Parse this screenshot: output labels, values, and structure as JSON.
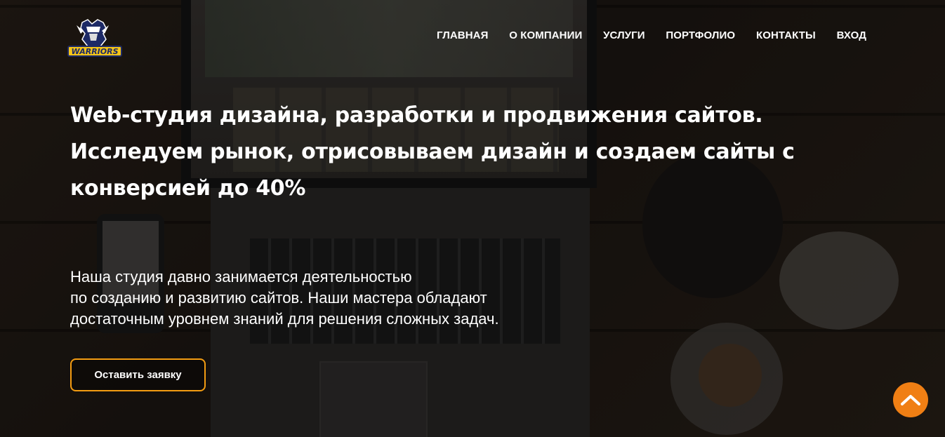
{
  "logo": {
    "text": "WARRIORS",
    "icon": "warriors-logo-icon"
  },
  "nav": {
    "items": [
      {
        "label": "ГЛАВНАЯ"
      },
      {
        "label": "О КОМПАНИИ"
      },
      {
        "label": "УСЛУГИ"
      },
      {
        "label": "ПОРТФОЛИО"
      },
      {
        "label": "КОНТАКТЫ"
      },
      {
        "label": "ВХОД"
      }
    ]
  },
  "hero": {
    "headline": "Web-студия дизайна, разработки и продвижения сайтов. Исследуем рынок, отрисовываем дизайн и создаем сайты с конверсией до 40%",
    "lead_lines": [
      "Наша студия давно занимается деятельностью",
      "по созданию и развитию сайтов. Наши мастера обладают",
      "достаточным уровнем знаний для решения сложных задач."
    ],
    "cta_label": "Оставить заявку"
  },
  "scroll_top": {
    "icon": "chevron-up-icon"
  },
  "colors": {
    "accent": "#f39c12",
    "scroll_button": "#f07f14",
    "text": "#ffffff",
    "logo_yellow": "#f5c518"
  }
}
